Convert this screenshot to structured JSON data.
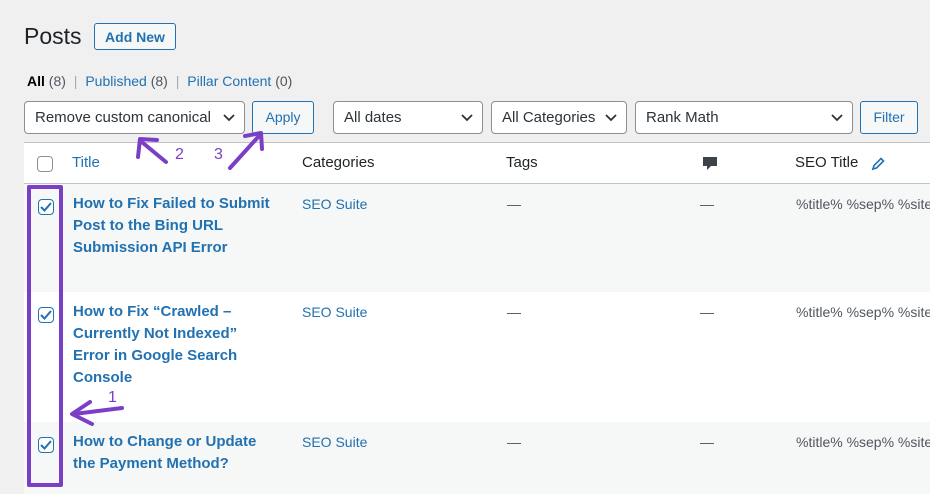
{
  "header": {
    "title": "Posts",
    "add_new": "Add New"
  },
  "views": {
    "all": "All",
    "all_count": "(8)",
    "published": "Published",
    "published_count": "(8)",
    "pillar": "Pillar Content",
    "pillar_count": "(0)",
    "separator": "|"
  },
  "filters": {
    "bulk_action": "Remove custom canonical",
    "apply": "Apply",
    "dates": "All dates",
    "categories": "All Categories",
    "seo_filter": "Rank Math",
    "filter": "Filter"
  },
  "table": {
    "columns": {
      "title": "Title",
      "categories": "Categories",
      "tags": "Tags",
      "seo_title": "SEO Title"
    },
    "rows": [
      {
        "title_lines": [
          "How to Fix Failed to Submit",
          "Post to the Bing URL",
          "Submission API Error"
        ],
        "category": "SEO Suite",
        "tags": "—",
        "comments": "—",
        "seo_title": "%title% %sep% %site",
        "checked": true
      },
      {
        "title_lines": [
          "How to Fix “Crawled –",
          "Currently Not Indexed”",
          "Error in Google Search",
          "Console"
        ],
        "category": "SEO Suite",
        "tags": "—",
        "comments": "—",
        "seo_title": "%title% %sep% %site",
        "checked": true
      },
      {
        "title_lines": [
          "How to Change or Update",
          "the Payment Method?"
        ],
        "category": "SEO Suite",
        "tags": "—",
        "comments": "—",
        "seo_title": "%title% %sep% %site",
        "checked": true
      }
    ]
  },
  "annotations": {
    "one": "1",
    "two": "2",
    "three": "3",
    "color": "#7b3fc6"
  },
  "icons": {
    "comment": "comment-bubble-icon",
    "edit": "pencil-icon",
    "chevron": "chevron-down-icon",
    "check": "checkmark-icon"
  }
}
